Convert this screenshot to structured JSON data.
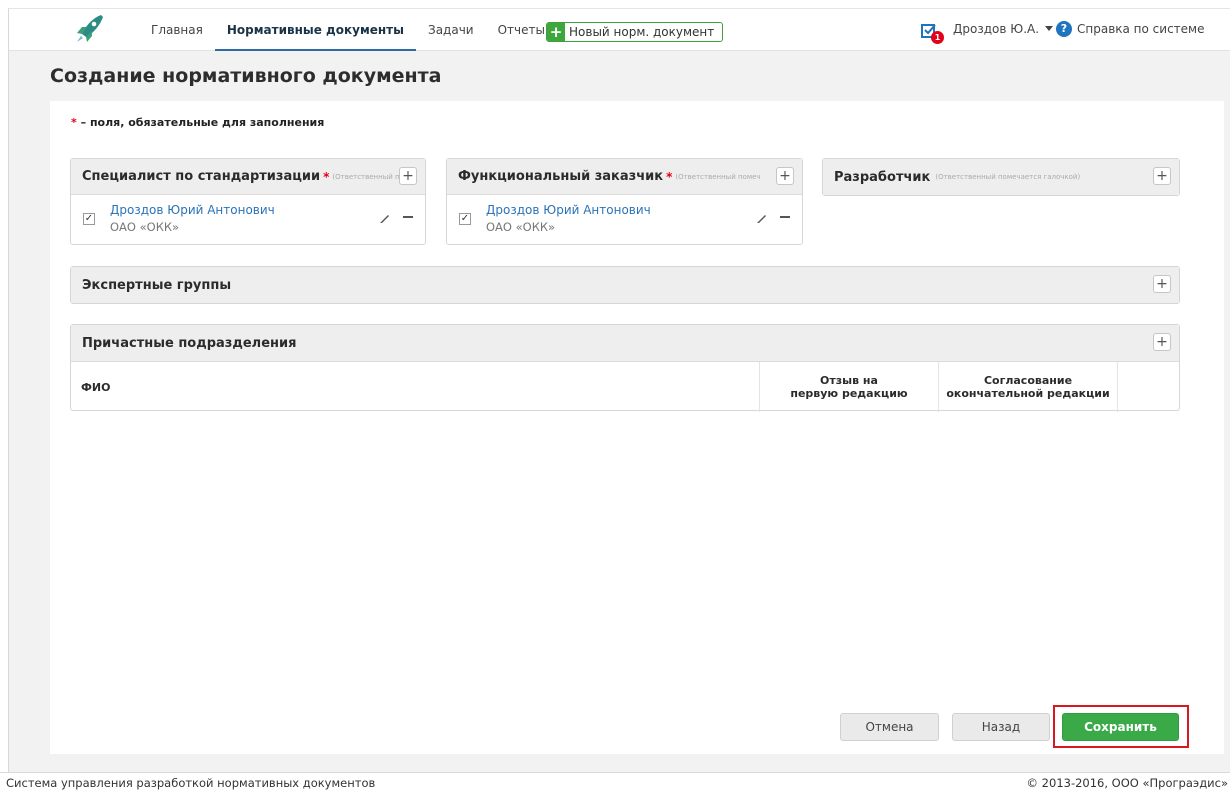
{
  "nav": {
    "items": [
      {
        "label": "Главная"
      },
      {
        "label": "Нормативные документы"
      },
      {
        "label": "Задачи"
      },
      {
        "label": "Отчеты"
      }
    ],
    "new_doc_label": "Новый норм. документ"
  },
  "user": {
    "task_count": "1",
    "name": "Дроздов Ю.А.",
    "help_label": "Справка по системе"
  },
  "page": {
    "title": "Создание нормативного документа",
    "required_note": "– поля, обязательные для заполнения"
  },
  "panels": {
    "specialist": {
      "title": "Специалист по стандартизации",
      "hint": "(Ответственный по",
      "person": {
        "name": "Дроздов Юрий Антонович",
        "org": "ОАО «ОКК»",
        "checked": "✓"
      }
    },
    "customer": {
      "title": "Функциональный заказчик",
      "hint": "(Ответственный помечае",
      "person": {
        "name": "Дроздов Юрий Антонович",
        "org": "ОАО «ОКК»",
        "checked": "✓"
      }
    },
    "developer": {
      "title": "Разработчик",
      "hint": "(Ответственный помечается галочкой)"
    },
    "experts": {
      "title": "Экспертные группы"
    },
    "departments": {
      "title": "Причастные подразделения",
      "columns": {
        "fio": "ФИО",
        "review_line1": "Отзыв на",
        "review_line2": "первую редакцию",
        "approval_line1": "Согласование",
        "approval_line2": "окончательной редакции"
      }
    }
  },
  "buttons": {
    "cancel": "Отмена",
    "back": "Назад",
    "save": "Сохранить"
  },
  "footer": {
    "left": "Система управления разработкой нормативных документов",
    "right": "© 2013-2016, ООО «Програэдис»"
  },
  "colors": {
    "accent_green": "#3aaa49",
    "link_blue": "#2a73b8",
    "required_red": "#e2001a",
    "highlight_red": "#d7191f"
  }
}
